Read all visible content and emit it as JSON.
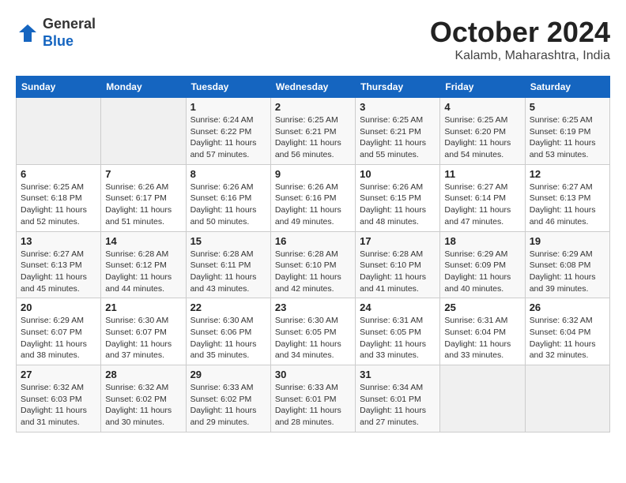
{
  "header": {
    "logo_general": "General",
    "logo_blue": "Blue",
    "month_title": "October 2024",
    "location": "Kalamb, Maharashtra, India"
  },
  "calendar": {
    "days_of_week": [
      "Sunday",
      "Monday",
      "Tuesday",
      "Wednesday",
      "Thursday",
      "Friday",
      "Saturday"
    ],
    "weeks": [
      [
        {
          "day": "",
          "info": ""
        },
        {
          "day": "",
          "info": ""
        },
        {
          "day": "1",
          "info": "Sunrise: 6:24 AM\nSunset: 6:22 PM\nDaylight: 11 hours and 57 minutes."
        },
        {
          "day": "2",
          "info": "Sunrise: 6:25 AM\nSunset: 6:21 PM\nDaylight: 11 hours and 56 minutes."
        },
        {
          "day": "3",
          "info": "Sunrise: 6:25 AM\nSunset: 6:21 PM\nDaylight: 11 hours and 55 minutes."
        },
        {
          "day": "4",
          "info": "Sunrise: 6:25 AM\nSunset: 6:20 PM\nDaylight: 11 hours and 54 minutes."
        },
        {
          "day": "5",
          "info": "Sunrise: 6:25 AM\nSunset: 6:19 PM\nDaylight: 11 hours and 53 minutes."
        }
      ],
      [
        {
          "day": "6",
          "info": "Sunrise: 6:25 AM\nSunset: 6:18 PM\nDaylight: 11 hours and 52 minutes."
        },
        {
          "day": "7",
          "info": "Sunrise: 6:26 AM\nSunset: 6:17 PM\nDaylight: 11 hours and 51 minutes."
        },
        {
          "day": "8",
          "info": "Sunrise: 6:26 AM\nSunset: 6:16 PM\nDaylight: 11 hours and 50 minutes."
        },
        {
          "day": "9",
          "info": "Sunrise: 6:26 AM\nSunset: 6:16 PM\nDaylight: 11 hours and 49 minutes."
        },
        {
          "day": "10",
          "info": "Sunrise: 6:26 AM\nSunset: 6:15 PM\nDaylight: 11 hours and 48 minutes."
        },
        {
          "day": "11",
          "info": "Sunrise: 6:27 AM\nSunset: 6:14 PM\nDaylight: 11 hours and 47 minutes."
        },
        {
          "day": "12",
          "info": "Sunrise: 6:27 AM\nSunset: 6:13 PM\nDaylight: 11 hours and 46 minutes."
        }
      ],
      [
        {
          "day": "13",
          "info": "Sunrise: 6:27 AM\nSunset: 6:13 PM\nDaylight: 11 hours and 45 minutes."
        },
        {
          "day": "14",
          "info": "Sunrise: 6:28 AM\nSunset: 6:12 PM\nDaylight: 11 hours and 44 minutes."
        },
        {
          "day": "15",
          "info": "Sunrise: 6:28 AM\nSunset: 6:11 PM\nDaylight: 11 hours and 43 minutes."
        },
        {
          "day": "16",
          "info": "Sunrise: 6:28 AM\nSunset: 6:10 PM\nDaylight: 11 hours and 42 minutes."
        },
        {
          "day": "17",
          "info": "Sunrise: 6:28 AM\nSunset: 6:10 PM\nDaylight: 11 hours and 41 minutes."
        },
        {
          "day": "18",
          "info": "Sunrise: 6:29 AM\nSunset: 6:09 PM\nDaylight: 11 hours and 40 minutes."
        },
        {
          "day": "19",
          "info": "Sunrise: 6:29 AM\nSunset: 6:08 PM\nDaylight: 11 hours and 39 minutes."
        }
      ],
      [
        {
          "day": "20",
          "info": "Sunrise: 6:29 AM\nSunset: 6:07 PM\nDaylight: 11 hours and 38 minutes."
        },
        {
          "day": "21",
          "info": "Sunrise: 6:30 AM\nSunset: 6:07 PM\nDaylight: 11 hours and 37 minutes."
        },
        {
          "day": "22",
          "info": "Sunrise: 6:30 AM\nSunset: 6:06 PM\nDaylight: 11 hours and 35 minutes."
        },
        {
          "day": "23",
          "info": "Sunrise: 6:30 AM\nSunset: 6:05 PM\nDaylight: 11 hours and 34 minutes."
        },
        {
          "day": "24",
          "info": "Sunrise: 6:31 AM\nSunset: 6:05 PM\nDaylight: 11 hours and 33 minutes."
        },
        {
          "day": "25",
          "info": "Sunrise: 6:31 AM\nSunset: 6:04 PM\nDaylight: 11 hours and 33 minutes."
        },
        {
          "day": "26",
          "info": "Sunrise: 6:32 AM\nSunset: 6:04 PM\nDaylight: 11 hours and 32 minutes."
        }
      ],
      [
        {
          "day": "27",
          "info": "Sunrise: 6:32 AM\nSunset: 6:03 PM\nDaylight: 11 hours and 31 minutes."
        },
        {
          "day": "28",
          "info": "Sunrise: 6:32 AM\nSunset: 6:02 PM\nDaylight: 11 hours and 30 minutes."
        },
        {
          "day": "29",
          "info": "Sunrise: 6:33 AM\nSunset: 6:02 PM\nDaylight: 11 hours and 29 minutes."
        },
        {
          "day": "30",
          "info": "Sunrise: 6:33 AM\nSunset: 6:01 PM\nDaylight: 11 hours and 28 minutes."
        },
        {
          "day": "31",
          "info": "Sunrise: 6:34 AM\nSunset: 6:01 PM\nDaylight: 11 hours and 27 minutes."
        },
        {
          "day": "",
          "info": ""
        },
        {
          "day": "",
          "info": ""
        }
      ]
    ]
  }
}
